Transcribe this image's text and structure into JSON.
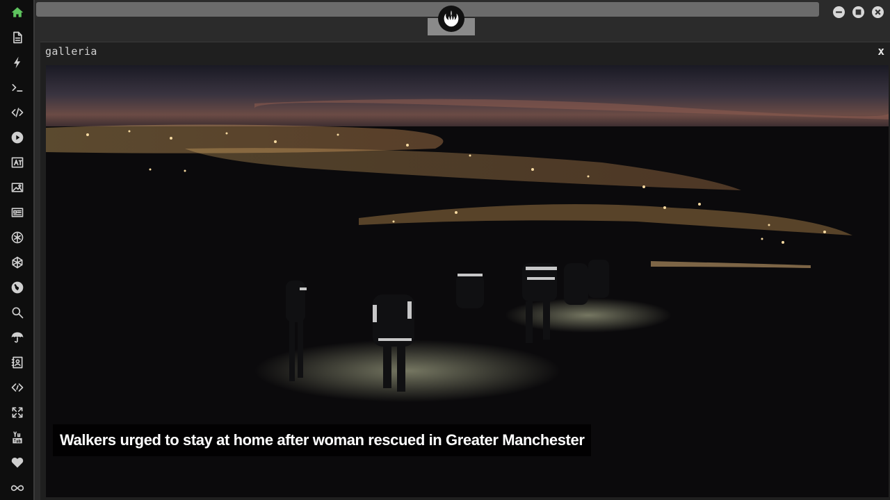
{
  "sidebar": {
    "items": [
      {
        "name": "home-icon"
      },
      {
        "name": "document-icon"
      },
      {
        "name": "lightning-icon"
      },
      {
        "name": "terminal-icon"
      },
      {
        "name": "code-icon"
      },
      {
        "name": "play-icon"
      },
      {
        "name": "translate-icon"
      },
      {
        "name": "image-icon"
      },
      {
        "name": "newspaper-icon"
      },
      {
        "name": "rebel-alliance-icon"
      },
      {
        "name": "hexagon-mesh-icon"
      },
      {
        "name": "globe-icon"
      },
      {
        "name": "search-icon"
      },
      {
        "name": "umbrella-icon"
      },
      {
        "name": "contact-book-icon"
      },
      {
        "name": "diamond-code-icon"
      },
      {
        "name": "expand-arrows-icon"
      },
      {
        "name": "youtube-icon"
      },
      {
        "name": "heart-icon"
      },
      {
        "name": "infinity-cloud-icon"
      }
    ],
    "active_color": "#5ec35e",
    "icon_color": "#cfcfcf"
  },
  "topbar": {
    "logo_icon": "rebel-alliance-icon",
    "window_controls": [
      "minimize-icon",
      "maximize-icon",
      "close-icon"
    ]
  },
  "panel": {
    "title": "galleria",
    "close_label": "x",
    "caption": "Walkers urged to stay at home after woman rescued in Greater Manchester"
  }
}
